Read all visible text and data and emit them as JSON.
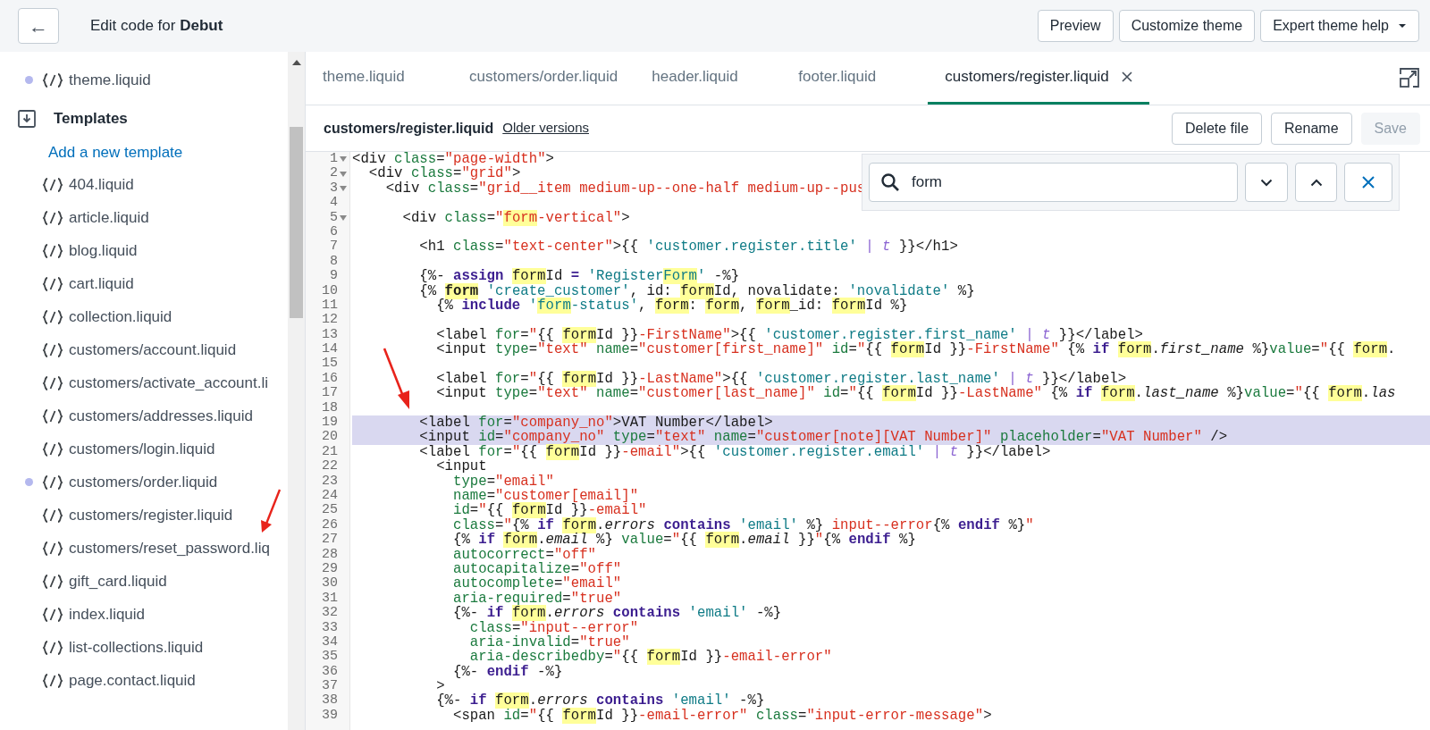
{
  "header": {
    "back_label": "←",
    "title": "Edit code for **Debut**",
    "buttons": [
      {
        "label": "Preview",
        "caret": false
      },
      {
        "label": "Customize theme",
        "caret": false
      },
      {
        "label": "Expert theme help",
        "caret": true
      }
    ]
  },
  "sidebar": {
    "items": [
      {
        "kind": "file",
        "label": "theme.liquid",
        "modified": true
      },
      {
        "kind": "section",
        "label": "Templates"
      },
      {
        "kind": "link",
        "label": "Add a new template"
      },
      {
        "kind": "file",
        "label": "404.liquid",
        "modified": false
      },
      {
        "kind": "file",
        "label": "article.liquid",
        "modified": false
      },
      {
        "kind": "file",
        "label": "blog.liquid",
        "modified": false
      },
      {
        "kind": "file",
        "label": "cart.liquid",
        "modified": false
      },
      {
        "kind": "file",
        "label": "collection.liquid",
        "modified": false
      },
      {
        "kind": "file",
        "label": "customers/account.liquid",
        "modified": false
      },
      {
        "kind": "file",
        "label": "customers/activate_account.li",
        "modified": false
      },
      {
        "kind": "file",
        "label": "customers/addresses.liquid",
        "modified": false
      },
      {
        "kind": "file",
        "label": "customers/login.liquid",
        "modified": false
      },
      {
        "kind": "file",
        "label": "customers/order.liquid",
        "modified": true
      },
      {
        "kind": "file",
        "label": "customers/register.liquid",
        "modified": false
      },
      {
        "kind": "file",
        "label": "customers/reset_password.liq",
        "modified": false
      },
      {
        "kind": "file",
        "label": "gift_card.liquid",
        "modified": false
      },
      {
        "kind": "file",
        "label": "index.liquid",
        "modified": false
      },
      {
        "kind": "file",
        "label": "list-collections.liquid",
        "modified": false
      },
      {
        "kind": "file",
        "label": "page.contact.liquid",
        "modified": false
      }
    ]
  },
  "tabs": [
    {
      "label": "theme.liquid",
      "selected": false,
      "closable": false
    },
    {
      "label": "customers/order.liquid",
      "selected": false,
      "closable": false
    },
    {
      "label": "header.liquid",
      "selected": false,
      "closable": false
    },
    {
      "label": "footer.liquid",
      "selected": false,
      "closable": false
    },
    {
      "label": "customers/register.liquid",
      "selected": true,
      "closable": true
    }
  ],
  "file_bar": {
    "filename": "customers/register.liquid",
    "link": "Older versions",
    "buttons": [
      {
        "label": "Delete file",
        "disabled": false
      },
      {
        "label": "Rename",
        "disabled": false
      },
      {
        "label": "Save",
        "disabled": true
      }
    ]
  },
  "search": {
    "value": "form"
  },
  "lines": [
    {
      "n": "1",
      "fold": true,
      "selected": false,
      "text": "<div class=\"page-width\">"
    },
    {
      "n": "2",
      "fold": true,
      "selected": false,
      "text": "  <div class=\"grid\">"
    },
    {
      "n": "3",
      "fold": true,
      "selected": false,
      "text": "    <div class=\"grid__item medium-up--one-half medium-up--pus"
    },
    {
      "n": "4",
      "fold": false,
      "selected": false
    },
    {
      "n": "5",
      "fold": true,
      "selected": false,
      "text": "      <div class=\"form-vertical\">"
    },
    {
      "n": "6",
      "fold": false,
      "selected": false
    },
    {
      "n": "7",
      "fold": false,
      "selected": false,
      "text": "        <h1 class=\"text-center\">{{ 'customer.register.title' | t }}</h1>"
    },
    {
      "n": "8",
      "fold": false,
      "selected": false
    },
    {
      "n": "9",
      "fold": false,
      "selected": false,
      "text": "        {%- assign formId = 'RegisterForm' -%}"
    },
    {
      "n": "10",
      "fold": false,
      "selected": false,
      "text": "        {% form 'create_customer', id: formId, novalidate: 'novalidate' %}"
    },
    {
      "n": "11",
      "fold": false,
      "selected": false,
      "text": "          {% include 'form-status', form: form, form_id: formId %}"
    },
    {
      "n": "12",
      "fold": false,
      "selected": false
    },
    {
      "n": "13",
      "fold": false,
      "selected": false,
      "text": "          <label for=\"{{ formId }}-FirstName\">{{ 'customer.register.first_name' | t }}</label>"
    },
    {
      "n": "14",
      "fold": false,
      "selected": false,
      "text": "          <input type=\"text\" name=\"customer[first_name]\" id=\"{{ formId }}-FirstName\" {% if form.first_name %}value=\"{{ form."
    },
    {
      "n": "15",
      "fold": false,
      "selected": false
    },
    {
      "n": "16",
      "fold": false,
      "selected": false,
      "text": "          <label for=\"{{ formId }}-LastName\">{{ 'customer.register.last_name' | t }}</label>"
    },
    {
      "n": "17",
      "fold": false,
      "selected": false,
      "text": "          <input type=\"text\" name=\"customer[last_name]\" id=\"{{ formId }}-LastName\" {% if form.last_name %}value=\"{{ form.las"
    },
    {
      "n": "18",
      "fold": false,
      "selected": false
    },
    {
      "n": "19",
      "fold": false,
      "selected": true,
      "text": "        <label for=\"company_no\">VAT Number</label>"
    },
    {
      "n": "20",
      "fold": false,
      "selected": true,
      "text": "        <input id=\"company_no\" type=\"text\" name=\"customer[note][VAT Number]\" placeholder=\"VAT Number\" />"
    },
    {
      "n": "21",
      "fold": false,
      "selected": false,
      "text": "        <label for=\"{{ formId }}-email\">{{ 'customer.register.email' | t }}</label>"
    },
    {
      "n": "22",
      "fold": false,
      "selected": false,
      "text": "          <input"
    },
    {
      "n": "23",
      "fold": false,
      "selected": false,
      "text": "            type=\"email\""
    },
    {
      "n": "24",
      "fold": false,
      "selected": false,
      "text": "            name=\"customer[email]\""
    },
    {
      "n": "25",
      "fold": false,
      "selected": false,
      "text": "            id=\"{{ formId }}-email\""
    },
    {
      "n": "26",
      "fold": false,
      "selected": false,
      "text": "            class=\"{% if form.errors contains 'email' %} input--error{% endif %}\""
    },
    {
      "n": "27",
      "fold": false,
      "selected": false,
      "text": "            {% if form.email %} value=\"{{ form.email }}\"{% endif %}"
    },
    {
      "n": "28",
      "fold": false,
      "selected": false,
      "text": "            autocorrect=\"off\""
    },
    {
      "n": "29",
      "fold": false,
      "selected": false,
      "text": "            autocapitalize=\"off\""
    },
    {
      "n": "30",
      "fold": false,
      "selected": false,
      "text": "            autocomplete=\"email\""
    },
    {
      "n": "31",
      "fold": false,
      "selected": false,
      "text": "            aria-required=\"true\""
    },
    {
      "n": "32",
      "fold": false,
      "selected": false,
      "text": "            {%- if form.errors contains 'email' -%}"
    },
    {
      "n": "33",
      "fold": false,
      "selected": false,
      "text": "              class=\"input--error\""
    },
    {
      "n": "34",
      "fold": false,
      "selected": false,
      "text": "              aria-invalid=\"true\""
    },
    {
      "n": "35",
      "fold": false,
      "selected": false,
      "text": "              aria-describedby=\"{{ formId }}-email-error\""
    },
    {
      "n": "36",
      "fold": false,
      "selected": false,
      "text": "            {%- endif -%}"
    },
    {
      "n": "37",
      "fold": false,
      "selected": false,
      "text": "          >"
    },
    {
      "n": "38",
      "fold": false,
      "selected": false,
      "text": "          {%- if form.errors contains 'email' -%}"
    },
    {
      "n": "39",
      "fold": false,
      "selected": false,
      "text": "            <span id=\"{{ formId }}-email-error\" class=\"input-error-message\">"
    }
  ]
}
